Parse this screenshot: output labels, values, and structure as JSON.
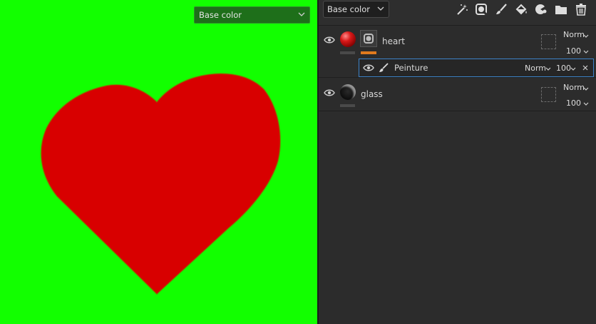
{
  "viewport": {
    "channel_dropdown": {
      "value": "Base color"
    },
    "background_color": "#12ff00",
    "heart_color": "#d80000"
  },
  "panel": {
    "toolbar": {
      "channel_dropdown": {
        "value": "Base color"
      },
      "icons": [
        "magic-wand-icon",
        "fill-layer-icon",
        "paint-brush-icon",
        "paint-bucket-icon",
        "smart-material-icon",
        "folder-icon",
        "trash-icon"
      ]
    },
    "layers": [
      {
        "name": "heart",
        "blend": "Norm",
        "opacity": "100",
        "sublayers": [
          {
            "name": "Peinture",
            "blend": "Norm",
            "opacity": "100"
          }
        ]
      },
      {
        "name": "glass",
        "blend": "Norm",
        "opacity": "100"
      }
    ]
  }
}
